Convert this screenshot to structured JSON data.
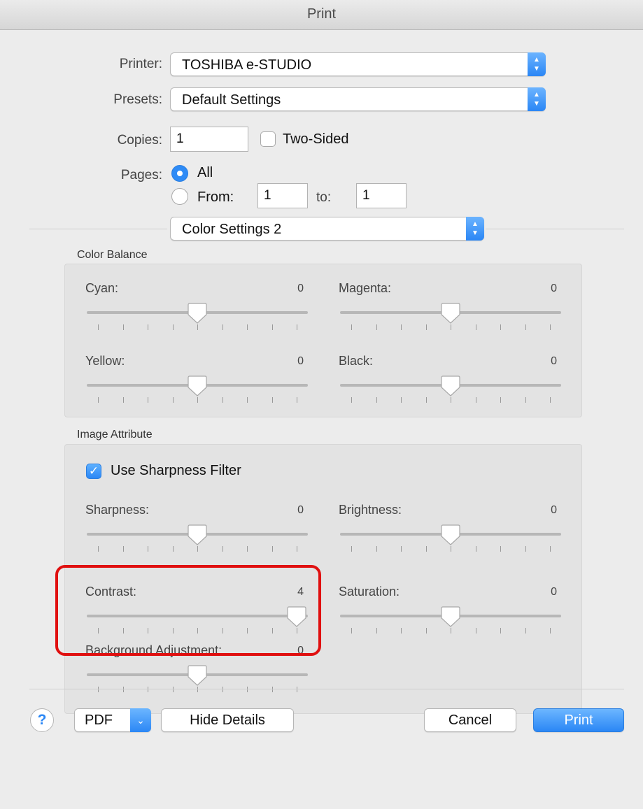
{
  "window": {
    "title": "Print"
  },
  "printer": {
    "label": "Printer:",
    "value": "TOSHIBA e-STUDIO"
  },
  "presets": {
    "label": "Presets:",
    "value": "Default Settings"
  },
  "copies": {
    "label": "Copies:",
    "value": "1",
    "two_sided_label": "Two-Sided",
    "two_sided_checked": false
  },
  "pages": {
    "label": "Pages:",
    "all_label": "All",
    "from_label": "From:",
    "from_value": "1",
    "to_label": "to:",
    "to_value": "1",
    "selected": "All"
  },
  "panel_selector": {
    "value": "Color Settings 2"
  },
  "color_balance": {
    "title": "Color Balance",
    "sliders": [
      {
        "label": "Cyan:",
        "value": "0"
      },
      {
        "label": "Magenta:",
        "value": "0"
      },
      {
        "label": "Yellow:",
        "value": "0"
      },
      {
        "label": "Black:",
        "value": "0"
      }
    ]
  },
  "image_attribute": {
    "title": "Image Attribute",
    "sharpness_filter_label": "Use Sharpness Filter",
    "sharpness_filter_checked": true,
    "sliders": [
      {
        "label": "Sharpness:",
        "value": "0"
      },
      {
        "label": "Brightness:",
        "value": "0"
      },
      {
        "label": "Contrast:",
        "value": "4"
      },
      {
        "label": "Saturation:",
        "value": "0"
      },
      {
        "label": "Background Adjustment:",
        "value": "0"
      }
    ]
  },
  "slider_range": {
    "min": -4,
    "max": 4
  },
  "footer": {
    "help_label": "?",
    "pdf_label": "PDF",
    "hide_details_label": "Hide Details",
    "cancel_label": "Cancel",
    "print_label": "Print"
  },
  "colors": {
    "accent": "#2b87f5",
    "highlight": "#e01010"
  }
}
